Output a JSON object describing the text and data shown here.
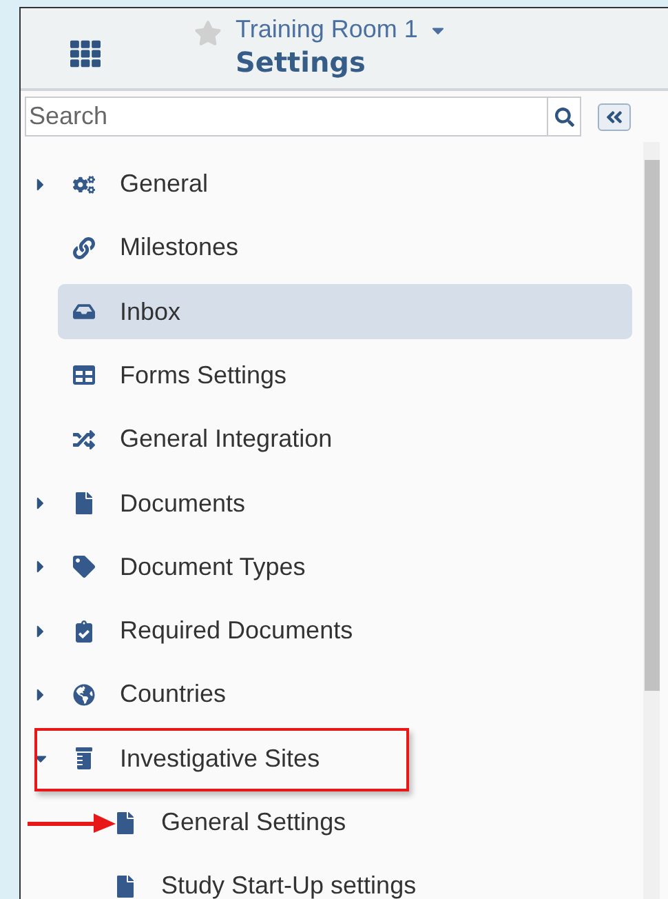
{
  "header": {
    "workspace": "Training Room 1",
    "favorite": false,
    "page_title": "Settings"
  },
  "search": {
    "placeholder": "Search"
  },
  "tree": [
    {
      "label": "General",
      "kind": "group",
      "expanded": false,
      "selected": false,
      "annotated": false,
      "pointed": false
    },
    {
      "label": "Milestones",
      "kind": "leaf",
      "selected": false,
      "annotated": false,
      "pointed": false
    },
    {
      "label": "Inbox",
      "kind": "leaf",
      "selected": true,
      "annotated": false,
      "pointed": false
    },
    {
      "label": "Forms Settings",
      "kind": "leaf",
      "selected": false,
      "annotated": false,
      "pointed": false
    },
    {
      "label": "General Integration",
      "kind": "leaf",
      "selected": false,
      "annotated": false,
      "pointed": false
    },
    {
      "label": "Documents",
      "kind": "group",
      "expanded": false,
      "selected": false,
      "annotated": false,
      "pointed": false
    },
    {
      "label": "Document Types",
      "kind": "group",
      "expanded": false,
      "selected": false,
      "annotated": false,
      "pointed": false
    },
    {
      "label": "Required Documents",
      "kind": "group",
      "expanded": false,
      "selected": false,
      "annotated": false,
      "pointed": false
    },
    {
      "label": "Countries",
      "kind": "group",
      "expanded": false,
      "selected": false,
      "annotated": false,
      "pointed": false
    },
    {
      "label": "Investigative Sites",
      "kind": "group",
      "expanded": true,
      "selected": false,
      "annotated": true,
      "pointed": false,
      "children": [
        {
          "label": "General Settings",
          "kind": "leaf",
          "selected": false,
          "annotated": false,
          "pointed": true
        },
        {
          "label": "Study Start-Up settings",
          "kind": "leaf",
          "selected": false,
          "annotated": false,
          "pointed": false
        }
      ]
    }
  ]
}
